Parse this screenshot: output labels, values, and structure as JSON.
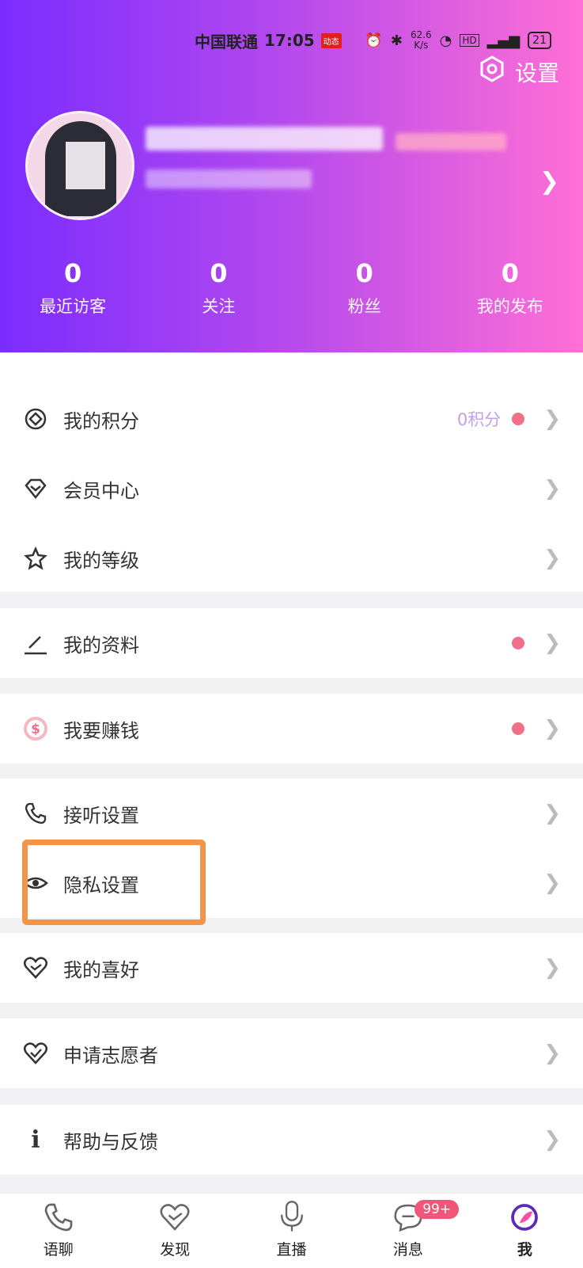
{
  "status_bar": {
    "carrier": "中国联通",
    "time": "17:05",
    "speed_top": "62.6",
    "speed_bottom": "K/s",
    "battery": "21"
  },
  "header": {
    "settings_label": "设置",
    "stats": [
      {
        "value": "0",
        "label": "最近访客"
      },
      {
        "value": "0",
        "label": "关注"
      },
      {
        "value": "0",
        "label": "粉丝"
      },
      {
        "value": "0",
        "label": "我的发布"
      }
    ]
  },
  "menu": {
    "points": {
      "label": "我的积分",
      "value": "0积分"
    },
    "vip": {
      "label": "会员中心"
    },
    "level": {
      "label": "我的等级"
    },
    "profile": {
      "label": "我的资料"
    },
    "earn": {
      "label": "我要赚钱"
    },
    "call_settings": {
      "label": "接听设置"
    },
    "privacy": {
      "label": "隐私设置"
    },
    "preferences": {
      "label": "我的喜好"
    },
    "volunteer": {
      "label": "申请志愿者"
    },
    "help": {
      "label": "帮助与反馈"
    }
  },
  "tabbar": {
    "tabs": [
      {
        "label": "语聊"
      },
      {
        "label": "发现"
      },
      {
        "label": "直播"
      },
      {
        "label": "消息",
        "badge": "99+"
      },
      {
        "label": "我"
      }
    ]
  },
  "colors": {
    "gradient_start": "#7b2cff",
    "gradient_end": "#ff6fd5",
    "highlight": "#f0954a",
    "dot": "#f0708a"
  }
}
